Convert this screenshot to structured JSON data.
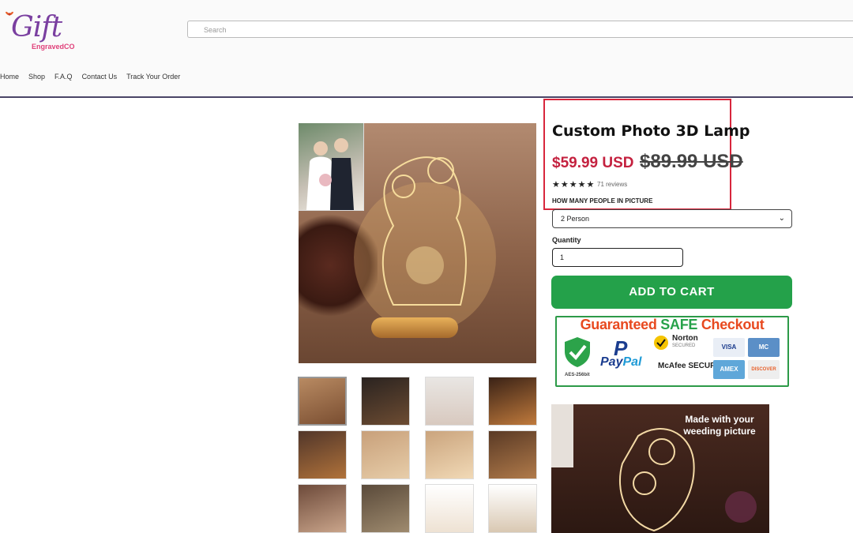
{
  "header": {
    "logo_text": "Gift",
    "logo_sub": "EngravedCO",
    "search_placeholder": "Search",
    "nav": [
      "Home",
      "Shop",
      "F.A.Q",
      "Contact Us",
      "Track Your Order"
    ]
  },
  "product": {
    "title": "Custom Photo 3D Lamp",
    "price": "$59.99 USD",
    "compare_price": "$89.99 USD",
    "stars": "★★★★★",
    "reviews": "71 reviews",
    "variant_label": "HOW MANY PEOPLE IN PICTURE",
    "variant_selected": "2 Person",
    "quantity_label": "Quantity",
    "quantity_value": "1",
    "add_to_cart": "ADD TO CART"
  },
  "trust_badge": {
    "title_part1": "Guaranteed",
    "title_part2": "SAFE",
    "title_part3": "Checkout",
    "aes": "AES-256bit",
    "paypal_a": "Pay",
    "paypal_b": "Pal",
    "norton": "Norton",
    "norton_sub": "SECURED",
    "mcafee": "McAfee SECURE",
    "cards": [
      "VISA",
      "MC",
      "AMEX",
      "DISCOVER"
    ]
  },
  "lifestyle": {
    "caption": "Made with your weeding picture"
  },
  "colors": {
    "accent_red": "#c4213f",
    "cart_green": "#24a14a",
    "highlight_box": "#d8263c"
  }
}
